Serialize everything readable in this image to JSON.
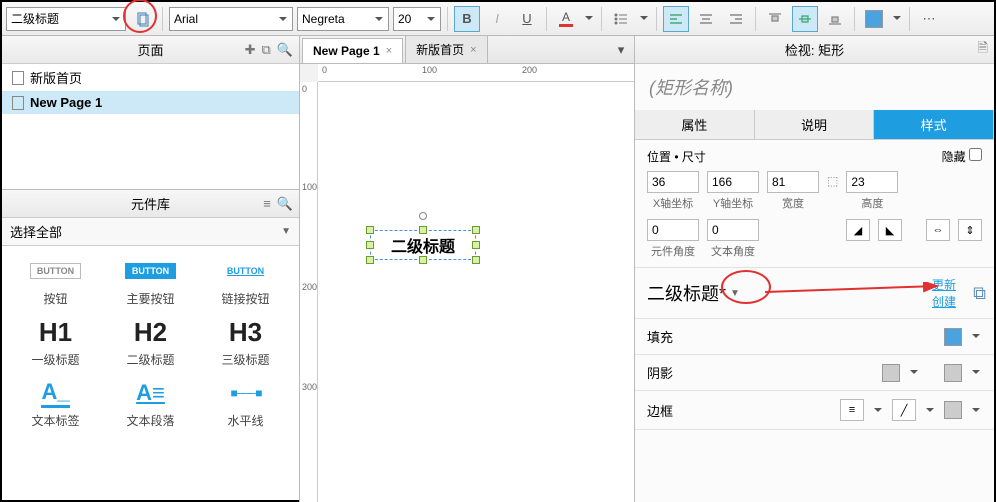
{
  "toolbar": {
    "style_combo": "二级标题",
    "font_combo": "Arial",
    "weight_combo": "Negreta",
    "size_combo": "20"
  },
  "pages": {
    "panel_title": "页面",
    "items": [
      "新版首页",
      "New Page 1"
    ],
    "selected": 1
  },
  "library": {
    "panel_title": "元件库",
    "select_all": "选择全部",
    "cells": [
      {
        "label": "按钮"
      },
      {
        "label": "主要按钮"
      },
      {
        "label": "链接按钮"
      },
      {
        "label": "一级标题"
      },
      {
        "label": "二级标题"
      },
      {
        "label": "三级标题"
      },
      {
        "label": "文本标签"
      },
      {
        "label": "文本段落"
      },
      {
        "label": "水平线"
      }
    ]
  },
  "canvas": {
    "tabs": [
      {
        "label": "New Page 1",
        "active": true
      },
      {
        "label": "新版首页",
        "active": false
      }
    ],
    "ruler_h": [
      "0",
      "100",
      "200"
    ],
    "ruler_v": [
      "0",
      "100",
      "200",
      "300"
    ],
    "shape_text": "二级标题"
  },
  "inspector": {
    "panel_title": "检视: 矩形",
    "name_placeholder": "(矩形名称)",
    "tabs": [
      "属性",
      "说明",
      "样式"
    ],
    "pos_section": "位置 • 尺寸",
    "hide_label": "隐藏",
    "x": "36",
    "x_label": "X轴坐标",
    "y": "166",
    "y_label": "Y轴坐标",
    "w": "81",
    "w_label": "宽度",
    "h": "23",
    "h_label": "高度",
    "rot": "0",
    "rot_label": "元件角度",
    "trot": "0",
    "trot_label": "文本角度",
    "style_name": "二级标题*",
    "link_update": "更新",
    "link_create": "创建",
    "fill": "填充",
    "shadow": "阴影",
    "border": "边框",
    "colors": {
      "fill": "#4aa3df",
      "shadow": "#cccccc",
      "border": "#cccccc",
      "toolbar_fill": "#4aa3df"
    }
  }
}
